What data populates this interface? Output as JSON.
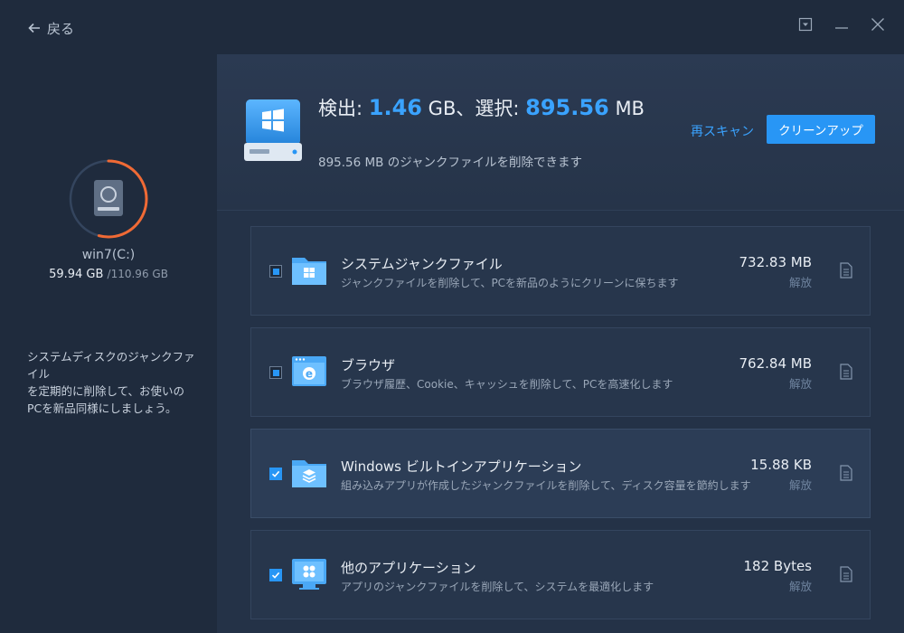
{
  "titlebar": {
    "back_label": "戻る"
  },
  "sidebar": {
    "disk_name": "win7(C:)",
    "disk_used": "59.94 GB",
    "disk_total": "/110.96 GB",
    "usage_fraction": 0.54,
    "description_lines": [
      "システムディスクのジャンクファイル",
      "を定期的に削除して、お使いの",
      "PCを新品同様にしましょう。"
    ]
  },
  "summary": {
    "found_label": "検出:",
    "found_value": "1.46",
    "found_unit": "GB、選択:",
    "selected_value": "895.56",
    "selected_unit": "MB",
    "subtext": "895.56 MB のジャンクファイルを削除できます",
    "rescan_label": "再スキャン",
    "cleanup_label": "クリーンアップ"
  },
  "items": [
    {
      "title": "システムジャンクファイル",
      "desc": "ジャンクファイルを削除して、PCを新品のようにクリーンに保ちます",
      "size": "732.83 MB",
      "detail": "解放",
      "state": "partial",
      "icon": "system-folder-icon"
    },
    {
      "title": "ブラウザ",
      "desc": "ブラウザ履歴、Cookie、キャッシュを削除して、PCを高速化します",
      "size": "762.84 MB",
      "detail": "解放",
      "state": "partial",
      "icon": "browser-icon"
    },
    {
      "title": "Windows ビルトインアプリケーション",
      "desc": "組み込みアプリが作成したジャンクファイルを削除して、ディスク容量を節約します",
      "size": "15.88 KB",
      "detail": "解放",
      "state": "checked",
      "icon": "builtin-apps-folder-icon"
    },
    {
      "title": "他のアプリケーション",
      "desc": "アプリのジャンクファイルを削除して、システムを最適化します",
      "size": "182 Bytes",
      "detail": "解放",
      "state": "checked",
      "icon": "other-apps-icon"
    }
  ],
  "colors": {
    "accent": "#2896f5",
    "ring": "#f06a35",
    "background": "#1f2b3d"
  }
}
